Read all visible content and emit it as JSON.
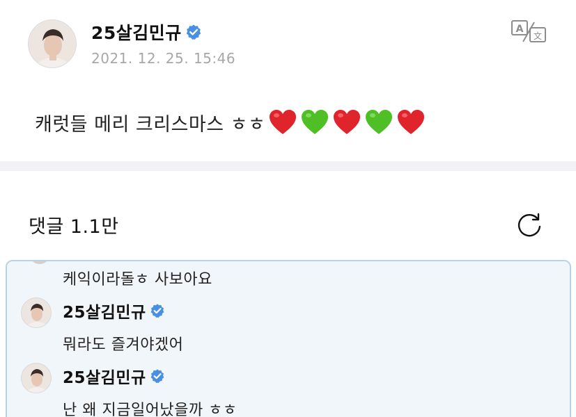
{
  "post": {
    "author": "25살김민규",
    "timestamp": "2021. 12. 25. 15:46",
    "body_text": "캐럿들 메리 크리스마스 ㅎㅎ",
    "emoji_sequence": [
      "red-heart",
      "green-heart",
      "red-heart",
      "green-heart",
      "red-heart"
    ],
    "verified": true
  },
  "comments": {
    "title": "댓글 1.1만"
  },
  "thread": {
    "partial_text": "케익이라돌ㅎ 사보아요",
    "replies": [
      {
        "author": "25살김민규",
        "text": "뭐라도 즐겨야겠어",
        "verified": true
      },
      {
        "author": "25살김민규",
        "text": "난 왜 지금일어났을까 ㅎㅎ",
        "verified": true
      }
    ]
  },
  "colors": {
    "verified_badge": "#4a90e2",
    "timestamp": "#a7a7a7",
    "reply_bg": "#f1f6fb",
    "reply_border": "#b7d3ea",
    "divider": "#f2f2f4",
    "red_heart": "#e0242b",
    "green_heart": "#4fbf26"
  },
  "icons": {
    "translate": "translate-icon",
    "refresh": "refresh-icon",
    "verified": "verified-badge-icon"
  }
}
